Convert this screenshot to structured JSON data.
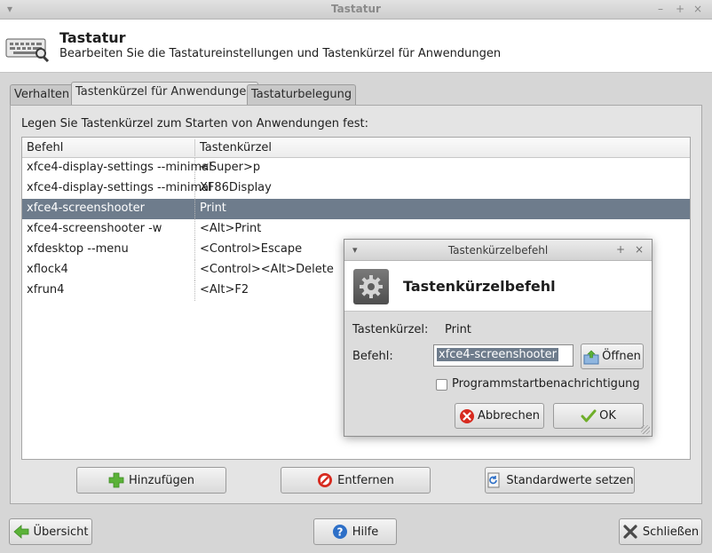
{
  "window": {
    "title": "Tastatur",
    "controls": [
      "–",
      "+",
      "×"
    ]
  },
  "header": {
    "title": "Tastatur",
    "subtitle": "Bearbeiten Sie die Tastatureinstellungen und Tastenkürzel für Anwendungen"
  },
  "tabs": [
    {
      "label": "Verhalten",
      "active": false
    },
    {
      "label": "Tastenkürzel für Anwendungen",
      "active": true
    },
    {
      "label": "Tastaturbelegung",
      "active": false
    }
  ],
  "shortcuts": {
    "section_label": "Legen Sie Tastenkürzel zum Starten von Anwendungen fest:",
    "columns": [
      "Befehl",
      "Tastenkürzel"
    ],
    "rows": [
      {
        "command": "xfce4-display-settings --minimal",
        "shortcut": "<Super>p"
      },
      {
        "command": "xfce4-display-settings --minimal",
        "shortcut": "XF86Display"
      },
      {
        "command": "xfce4-screenshooter",
        "shortcut": "Print"
      },
      {
        "command": "xfce4-screenshooter -w",
        "shortcut": "<Alt>Print"
      },
      {
        "command": "xfdesktop --menu",
        "shortcut": "<Control>Escape"
      },
      {
        "command": "xflock4",
        "shortcut": "<Control><Alt>Delete"
      },
      {
        "command": "xfrun4",
        "shortcut": "<Alt>F2"
      }
    ],
    "selected_index": 2
  },
  "actions": {
    "add": "Hinzufügen",
    "remove": "Entfernen",
    "reset": "Standardwerte setzen"
  },
  "footer": {
    "overview": "Übersicht",
    "help": "Hilfe",
    "close": "Schließen"
  },
  "dialog": {
    "title": "Tastenkürzelbefehl",
    "controls": [
      "+",
      "×"
    ],
    "header_title": "Tastenkürzelbefehl",
    "shortcut_label": "Tastenkürzel:",
    "shortcut_value": "Print",
    "command_label": "Befehl:",
    "command_value": "xfce4-screenshooter",
    "open_button": "Öffnen",
    "checkbox_label": "Programmstartbenachrichtigung",
    "checkbox_checked": false,
    "cancel_button": "Abbrechen",
    "ok_button": "OK"
  },
  "colors": {
    "selection": "#6e7c8c",
    "add_icon": "#5bb238",
    "remove_icon": "#d72a1f",
    "help_icon": "#2d6fc7"
  }
}
